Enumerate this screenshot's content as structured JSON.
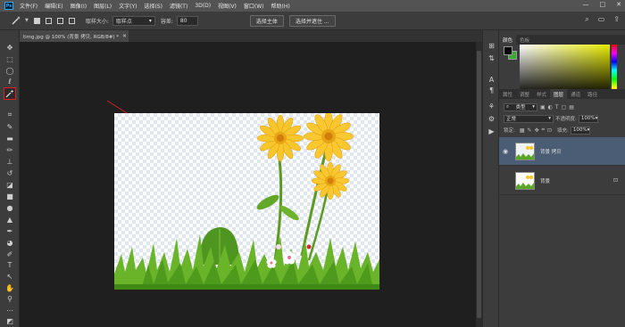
{
  "menubar": {
    "logo": "Ps",
    "items": [
      "文件(F)",
      "编辑(E)",
      "图像(I)",
      "图层(L)",
      "文字(Y)",
      "选择(S)",
      "滤镜(T)",
      "3D(D)",
      "视图(V)",
      "窗口(W)",
      "帮助(H)"
    ],
    "controls": [
      "—",
      "□",
      "✕"
    ]
  },
  "options": {
    "tool_icon": "magic-wand-icon",
    "sample_size_label": "取样大小:",
    "sample_size_value": "取样点",
    "tolerance_label": "容差:",
    "tolerance_value": "80",
    "select_subject": "选择主体",
    "select_and_mask": "选择并遮住 ..."
  },
  "document": {
    "tab_title": "timg.jpg @ 100% (背景 拷贝, RGB/8#) *",
    "tab_close": "✕"
  },
  "panels": {
    "top_tabs": [
      "颜色",
      "色板"
    ],
    "layers_tabs": [
      "属性",
      "调整",
      "样式",
      "图层",
      "通道",
      "路径"
    ],
    "filter_kind": "类型",
    "blend_mode": "正常",
    "opacity_label": "不透明度:",
    "opacity_value": "100%",
    "lock_label": "锁定:",
    "fill_label": "填充:",
    "fill_value": "100%",
    "layers": [
      {
        "name": "背景 拷贝",
        "visible": true,
        "active": true
      },
      {
        "name": "背景",
        "visible": false,
        "active": false,
        "locked": true
      }
    ]
  },
  "colors": {
    "foreground": "#000000",
    "background": "#3fa832",
    "selection": "#e02020"
  }
}
